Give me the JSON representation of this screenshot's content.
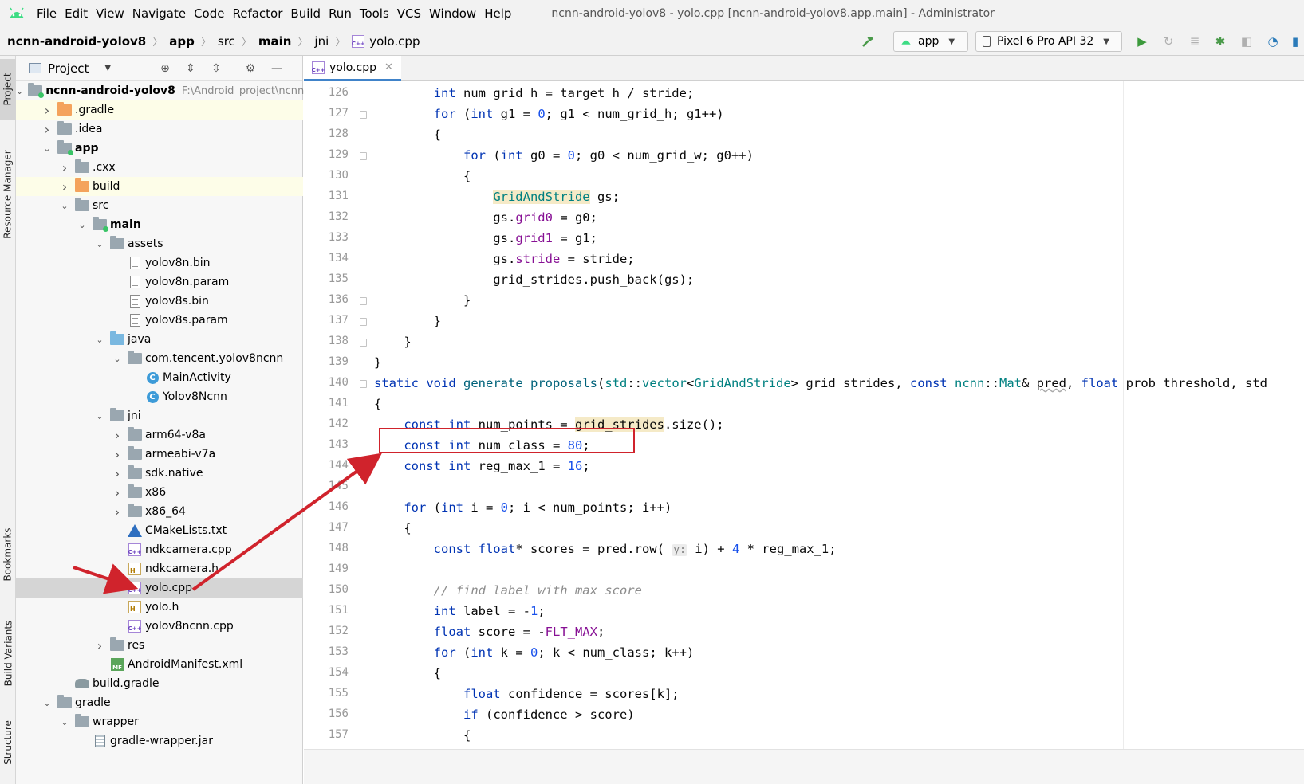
{
  "menubar": {
    "items": [
      "File",
      "Edit",
      "View",
      "Navigate",
      "Code",
      "Refactor",
      "Build",
      "Run",
      "Tools",
      "VCS",
      "Window",
      "Help"
    ],
    "title": "ncnn-android-yolov8 - yolo.cpp [ncnn-android-yolov8.app.main] - Administrator"
  },
  "breadcrumb": [
    "ncnn-android-yolov8",
    "app",
    "src",
    "main",
    "jni",
    "yolo.cpp"
  ],
  "run_config": {
    "module": "app",
    "device": "Pixel 6 Pro API 32"
  },
  "toolwindows": {
    "project": "Project",
    "resource_manager": "Resource Manager",
    "bookmarks": "Bookmarks",
    "build_variants": "Build Variants",
    "structure": "Structure"
  },
  "project_panel": {
    "title": "Project",
    "tree": [
      {
        "label": "ncnn-android-yolov8",
        "path": "F:\\Android_project\\ncnn",
        "indent": 0,
        "chev": "down",
        "icon": "module-folder",
        "bold": true
      },
      {
        "label": ".gradle",
        "indent": 1,
        "chev": "right",
        "icon": "folder-orange",
        "hl": true
      },
      {
        "label": ".idea",
        "indent": 1,
        "chev": "right",
        "icon": "folder"
      },
      {
        "label": "app",
        "indent": 1,
        "chev": "down",
        "icon": "module-folder",
        "bold": true
      },
      {
        "label": ".cxx",
        "indent": 2,
        "chev": "right",
        "icon": "folder"
      },
      {
        "label": "build",
        "indent": 2,
        "chev": "right",
        "icon": "folder-orange",
        "hl": true
      },
      {
        "label": "src",
        "indent": 2,
        "chev": "down",
        "icon": "folder"
      },
      {
        "label": "main",
        "indent": 3,
        "chev": "down",
        "icon": "module-folder",
        "bold": true
      },
      {
        "label": "assets",
        "indent": 4,
        "chev": "down",
        "icon": "folder"
      },
      {
        "label": "yolov8n.bin",
        "indent": 5,
        "chev": "",
        "icon": "file"
      },
      {
        "label": "yolov8n.param",
        "indent": 5,
        "chev": "",
        "icon": "file"
      },
      {
        "label": "yolov8s.bin",
        "indent": 5,
        "chev": "",
        "icon": "file"
      },
      {
        "label": "yolov8s.param",
        "indent": 5,
        "chev": "",
        "icon": "file"
      },
      {
        "label": "java",
        "indent": 4,
        "chev": "down",
        "icon": "folder-blue"
      },
      {
        "label": "com.tencent.yolov8ncnn",
        "indent": 5,
        "chev": "down",
        "icon": "folder"
      },
      {
        "label": "MainActivity",
        "indent": 6,
        "chev": "",
        "icon": "class"
      },
      {
        "label": "Yolov8Ncnn",
        "indent": 6,
        "chev": "",
        "icon": "class"
      },
      {
        "label": "jni",
        "indent": 4,
        "chev": "down",
        "icon": "folder"
      },
      {
        "label": "arm64-v8a",
        "indent": 5,
        "chev": "right",
        "icon": "folder"
      },
      {
        "label": "armeabi-v7a",
        "indent": 5,
        "chev": "right",
        "icon": "folder"
      },
      {
        "label": "sdk.native",
        "indent": 5,
        "chev": "right",
        "icon": "folder"
      },
      {
        "label": "x86",
        "indent": 5,
        "chev": "right",
        "icon": "folder"
      },
      {
        "label": "x86_64",
        "indent": 5,
        "chev": "right",
        "icon": "folder"
      },
      {
        "label": "CMakeLists.txt",
        "indent": 5,
        "chev": "",
        "icon": "cmake"
      },
      {
        "label": "ndkcamera.cpp",
        "indent": 5,
        "chev": "",
        "icon": "cpp"
      },
      {
        "label": "ndkcamera.h",
        "indent": 5,
        "chev": "",
        "icon": "h"
      },
      {
        "label": "yolo.cpp",
        "indent": 5,
        "chev": "",
        "icon": "cpp",
        "sel": true
      },
      {
        "label": "yolo.h",
        "indent": 5,
        "chev": "",
        "icon": "h"
      },
      {
        "label": "yolov8ncnn.cpp",
        "indent": 5,
        "chev": "",
        "icon": "cpp"
      },
      {
        "label": "res",
        "indent": 4,
        "chev": "right",
        "icon": "folder"
      },
      {
        "label": "AndroidManifest.xml",
        "indent": 4,
        "chev": "",
        "icon": "mf"
      },
      {
        "label": "build.gradle",
        "indent": 2,
        "chev": "",
        "icon": "gradle"
      },
      {
        "label": "gradle",
        "indent": 1,
        "chev": "down",
        "icon": "folder"
      },
      {
        "label": "wrapper",
        "indent": 2,
        "chev": "down",
        "icon": "folder"
      },
      {
        "label": "gradle-wrapper.jar",
        "indent": 3,
        "chev": "",
        "icon": "jar"
      }
    ]
  },
  "editor": {
    "tab": "yolo.cpp",
    "line_numbers": [
      "126",
      "127",
      "128",
      "129",
      "130",
      "131",
      "132",
      "133",
      "134",
      "135",
      "136",
      "137",
      "138",
      "139",
      "140",
      "141",
      "142",
      "143",
      "144",
      "145",
      "146",
      "147",
      "148",
      "149",
      "150",
      "151",
      "152",
      "153",
      "154",
      "155",
      "156",
      "157"
    ],
    "lines": [
      "        <span class=\"kw\">int</span> num_grid_h = target_h / stride;",
      "        <span class=\"kw\">for</span> (<span class=\"kw\">int</span> g1 = <span class=\"num\">0</span>; g1 &lt; num_grid_h; g1++)",
      "        {",
      "            <span class=\"kw\">for</span> (<span class=\"kw\">int</span> g0 = <span class=\"num\">0</span>; g0 &lt; num_grid_w; g0++)",
      "            {",
      "                <span class=\"typ hlbg\">GridAndStride</span> gs;",
      "                gs.<span class=\"fld\">grid0</span> = g0;",
      "                gs.<span class=\"fld\">grid1</span> = g1;",
      "                gs.<span class=\"fld\">stride</span> = stride;",
      "                grid_strides.push_back(gs);",
      "            }",
      "        }",
      "    }",
      "}",
      "<span class=\"kw\">static void</span> <span class=\"ty\">generate_proposals</span>(<span class=\"typ\">std</span>::<span class=\"typ\">vector</span>&lt;<span class=\"typ\">GridAndStride</span>&gt; grid_strides, <span class=\"kw\">const</span> <span class=\"typ\">ncnn</span>::<span class=\"typ\">Mat</span>&amp; <span class=\"squig\">pred</span>, <span class=\"kw\">float</span> prob_threshold, std",
      "{",
      "    <span class=\"kw\">const int</span> num_points = <span class=\"hlbg\">grid_strides</span>.size();",
      "    <span class=\"kw\">const int</span> num_class = <span class=\"num\">80</span>;",
      "    <span class=\"kw\">const int</span> reg_max_1 = <span class=\"num\">16</span>;",
      "",
      "    <span class=\"kw\">for</span> (<span class=\"kw\">int</span> i = <span class=\"num\">0</span>; i &lt; num_points; i++)",
      "    {",
      "        <span class=\"kw\">const float</span>* scores = pred.row( <span class=\"hint\">y:</span> i) + <span class=\"num\">4</span> * reg_max_1;",
      "",
      "        <span class=\"cm\">// find label with max score</span>",
      "        <span class=\"kw\">int</span> label = -<span class=\"num\">1</span>;",
      "        <span class=\"kw\">float</span> score = -<span class=\"fld\">FLT_MAX</span>;",
      "        <span class=\"kw\">for</span> (<span class=\"kw\">int</span> k = <span class=\"num\">0</span>; k &lt; num_class; k++)",
      "        {",
      "            <span class=\"kw\">float</span> confidence = scores[k];",
      "            <span class=\"kw\">if</span> (confidence &gt; score)",
      "            {"
    ]
  },
  "colors": {
    "accent": "#4083c9",
    "annotation": "#d0232c"
  },
  "icons": [
    "android-logo-icon",
    "hammer-icon",
    "run-icon",
    "rerun-icon",
    "debug-icon",
    "profiler-icon",
    "crosshair-icon",
    "expand-all-icon",
    "collapse-all-icon",
    "gear-icon",
    "minimize-icon"
  ]
}
